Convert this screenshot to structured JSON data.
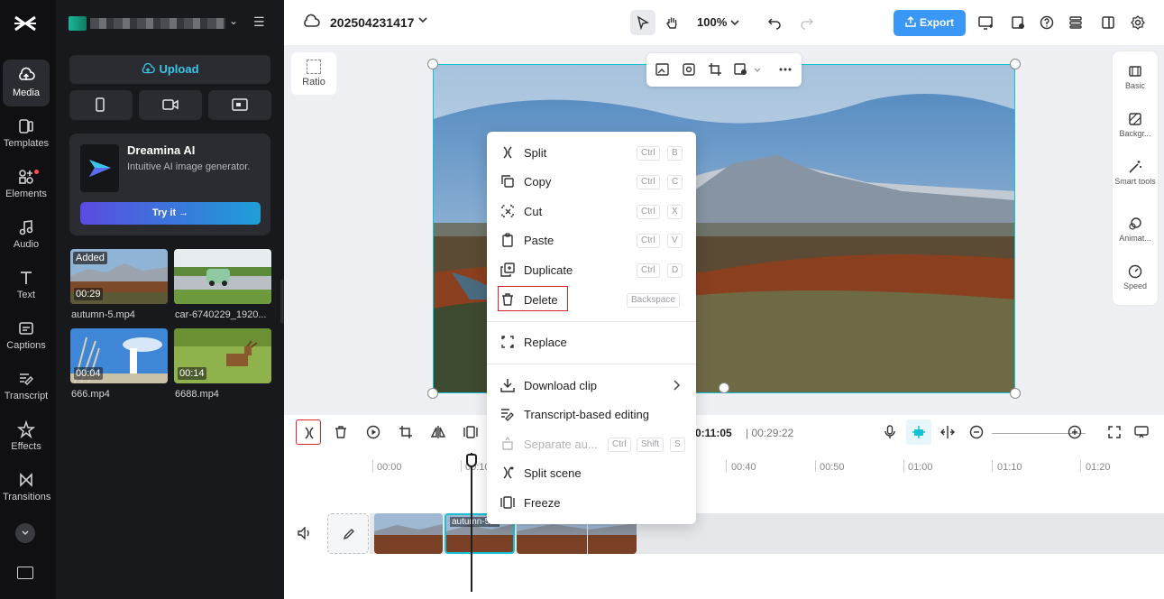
{
  "rail": {
    "items": [
      {
        "label": "Media",
        "icon": "cloud-upload-icon",
        "active": true
      },
      {
        "label": "Templates",
        "icon": "templates-icon"
      },
      {
        "label": "Elements",
        "icon": "elements-icon",
        "dot": true
      },
      {
        "label": "Audio",
        "icon": "music-note-icon"
      },
      {
        "label": "Text",
        "icon": "text-T-icon"
      },
      {
        "label": "Captions",
        "icon": "captions-icon"
      },
      {
        "label": "Transcript",
        "icon": "transcript-icon"
      },
      {
        "label": "Effects",
        "icon": "effects-star-icon"
      },
      {
        "label": "Transitions",
        "icon": "transitions-bowtie-icon"
      }
    ]
  },
  "media_panel": {
    "upload_label": "Upload",
    "dreamina": {
      "title": "Dreamina AI",
      "subtitle": "Intuitive AI image generator.",
      "button_label": "Try it →"
    },
    "assets": [
      {
        "name": "autumn-5.mp4",
        "duration": "00:29",
        "badge": "Added"
      },
      {
        "name": "car-6740229_1920...",
        "duration": ""
      },
      {
        "name": "666.mp4",
        "duration": "00:04"
      },
      {
        "name": "6688.mp4",
        "duration": "00:14"
      }
    ]
  },
  "topbar": {
    "project_title": "202504231417",
    "zoom": "100%",
    "export_label": "Export"
  },
  "canvas": {
    "ratio_label": "Ratio"
  },
  "right_panel": {
    "items": [
      {
        "label": "Basic"
      },
      {
        "label": "Backgr..."
      },
      {
        "label": "Smart tools"
      },
      {
        "label": "Animat..."
      },
      {
        "label": "Speed"
      }
    ]
  },
  "timeline": {
    "current_time": "0:11:05",
    "total_time": "| 00:29:22",
    "ticks": [
      "00:00",
      "00:10",
      "00:40",
      "00:50",
      "01:00",
      "01:10",
      "01:20"
    ],
    "selected_clip_label": "autumn-5..."
  },
  "context_menu": {
    "items": [
      {
        "label": "Split",
        "keys": [
          "Ctrl",
          "B"
        ],
        "icon": "split-icon"
      },
      {
        "label": "Copy",
        "keys": [
          "Ctrl",
          "C"
        ],
        "icon": "copy-icon"
      },
      {
        "label": "Cut",
        "keys": [
          "Ctrl",
          "X"
        ],
        "icon": "cut-icon"
      },
      {
        "label": "Paste",
        "keys": [
          "Ctrl",
          "V"
        ],
        "icon": "paste-icon"
      },
      {
        "label": "Duplicate",
        "keys": [
          "Ctrl",
          "D"
        ],
        "icon": "duplicate-icon"
      },
      {
        "label": "Delete",
        "keys": [
          "Backspace"
        ],
        "icon": "trash-icon",
        "highlighted": true
      },
      {
        "label": "Replace",
        "icon": "replace-icon"
      },
      {
        "label": "Download clip",
        "icon": "download-icon",
        "submenu": true
      },
      {
        "label": "Transcript-based editing",
        "icon": "transcript-edit-icon"
      },
      {
        "label": "Separate au...",
        "keys": [
          "Ctrl",
          "Shift",
          "S"
        ],
        "icon": "separate-audio-icon",
        "disabled": true
      },
      {
        "label": "Split scene",
        "icon": "split-scene-icon"
      },
      {
        "label": "Freeze",
        "icon": "freeze-icon"
      }
    ]
  },
  "colors": {
    "accent": "#14c1d1",
    "export": "#3a97f5",
    "highlight_red": "#d6262c",
    "panel_bg": "#18191d",
    "rail_bg": "#101012"
  }
}
